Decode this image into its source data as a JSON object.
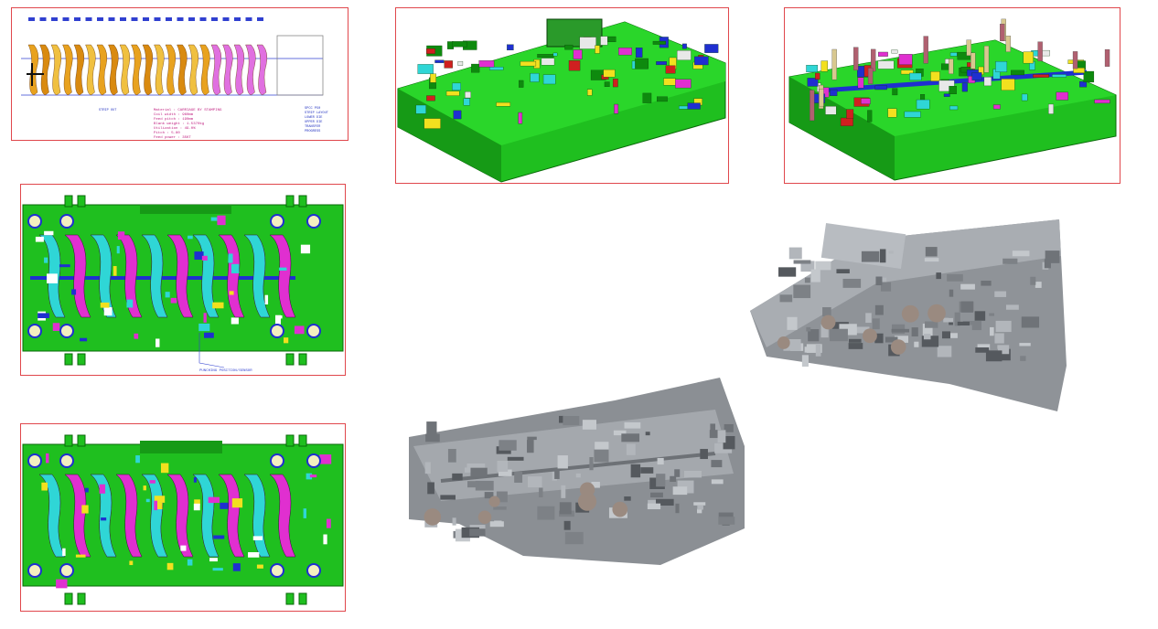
{
  "strip_layout": {
    "info_lines": [
      "Material : CARRIAGE BY STAMPING",
      "Coil width : 960mm",
      "Feed pitch : 190mm",
      "Blank weight : 1.5370kg",
      "Utilization : 49.0%",
      "Pitch : 5.80",
      "Feed power : 35KT"
    ],
    "title_block": [
      "SPCC P50",
      "STRIP LAYOUT",
      "LOWER DIE",
      "UPPER DIE",
      "TRANSFER",
      "PROGRESS"
    ],
    "note_label": "STRIP OUT"
  },
  "plan_view_lower": {
    "callout": "PUNCHING POSITION/SENSOR"
  },
  "colors": {
    "frame": "#e0474c",
    "die_green": "#1fbf1f",
    "insert_cyan": "#2fd6d6",
    "insert_magenta": "#e02fd0",
    "plate_blue": "#1f2fd0",
    "accent_yellow": "#f2e01f",
    "steel": "#9a9ea3"
  },
  "icons": [
    "die-cad-3d",
    "die-cad-plan",
    "strip-layout-drawing",
    "die-photo"
  ]
}
